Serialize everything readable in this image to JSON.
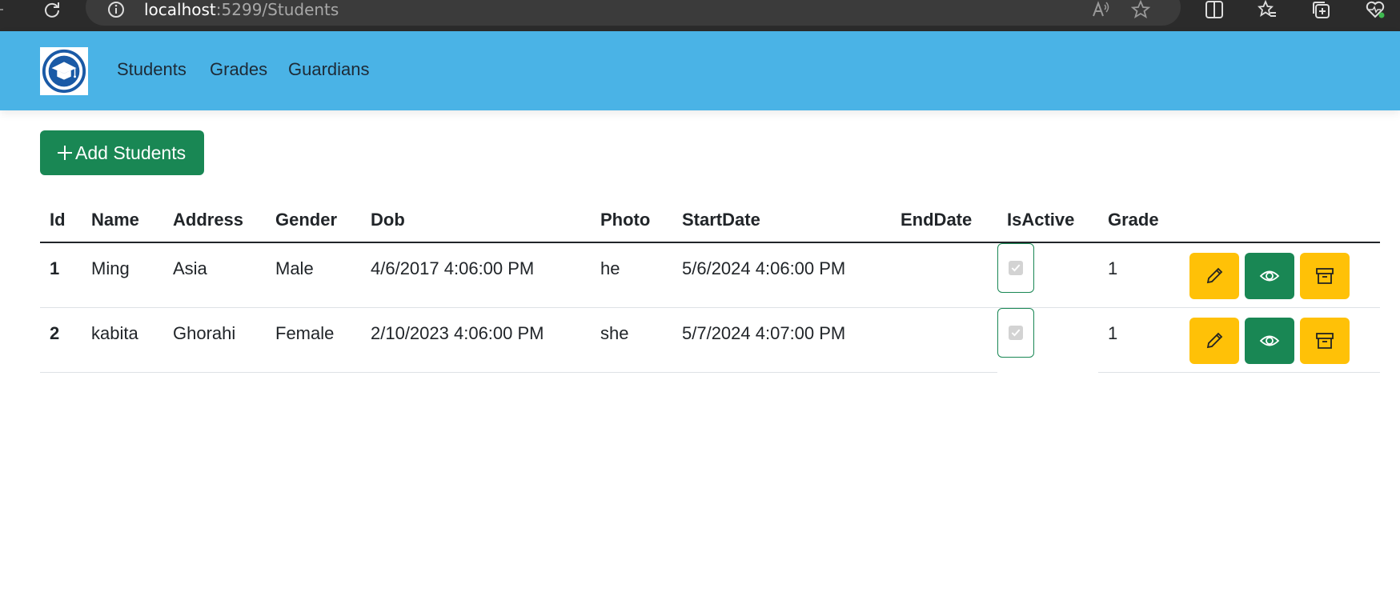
{
  "browser": {
    "url_host": "localhost",
    "url_path": ":5299/Students"
  },
  "nav": {
    "links": [
      "Students",
      "Grades",
      "Guardians"
    ]
  },
  "add_button_label": "Add Students",
  "table": {
    "headers": [
      "Id",
      "Name",
      "Address",
      "Gender",
      "Dob",
      "Photo",
      "StartDate",
      "EndDate",
      "IsActive",
      "Grade"
    ],
    "rows": [
      {
        "id": "1",
        "name": "Ming",
        "address": "Asia",
        "gender": "Male",
        "dob": "4/6/2017 4:06:00 PM",
        "photo": "he",
        "start_date": "5/6/2024 4:06:00 PM",
        "end_date": "",
        "is_active": true,
        "grade": "1"
      },
      {
        "id": "2",
        "name": "kabita",
        "address": "Ghorahi",
        "gender": "Female",
        "dob": "2/10/2023 4:06:00 PM",
        "photo": "she",
        "start_date": "5/7/2024 4:07:00 PM",
        "end_date": "",
        "is_active": true,
        "grade": "1"
      }
    ],
    "row_actions": [
      {
        "icon": "pencil-icon",
        "color": "#ffc107"
      },
      {
        "icon": "eye-icon",
        "color": "#198754"
      },
      {
        "icon": "archive-icon",
        "color": "#ffc107"
      }
    ]
  },
  "colors": {
    "navbar": "#4ab3e6",
    "primary_green": "#198754",
    "warning_yellow": "#ffc107",
    "logo_blue": "#1a5aa6"
  }
}
